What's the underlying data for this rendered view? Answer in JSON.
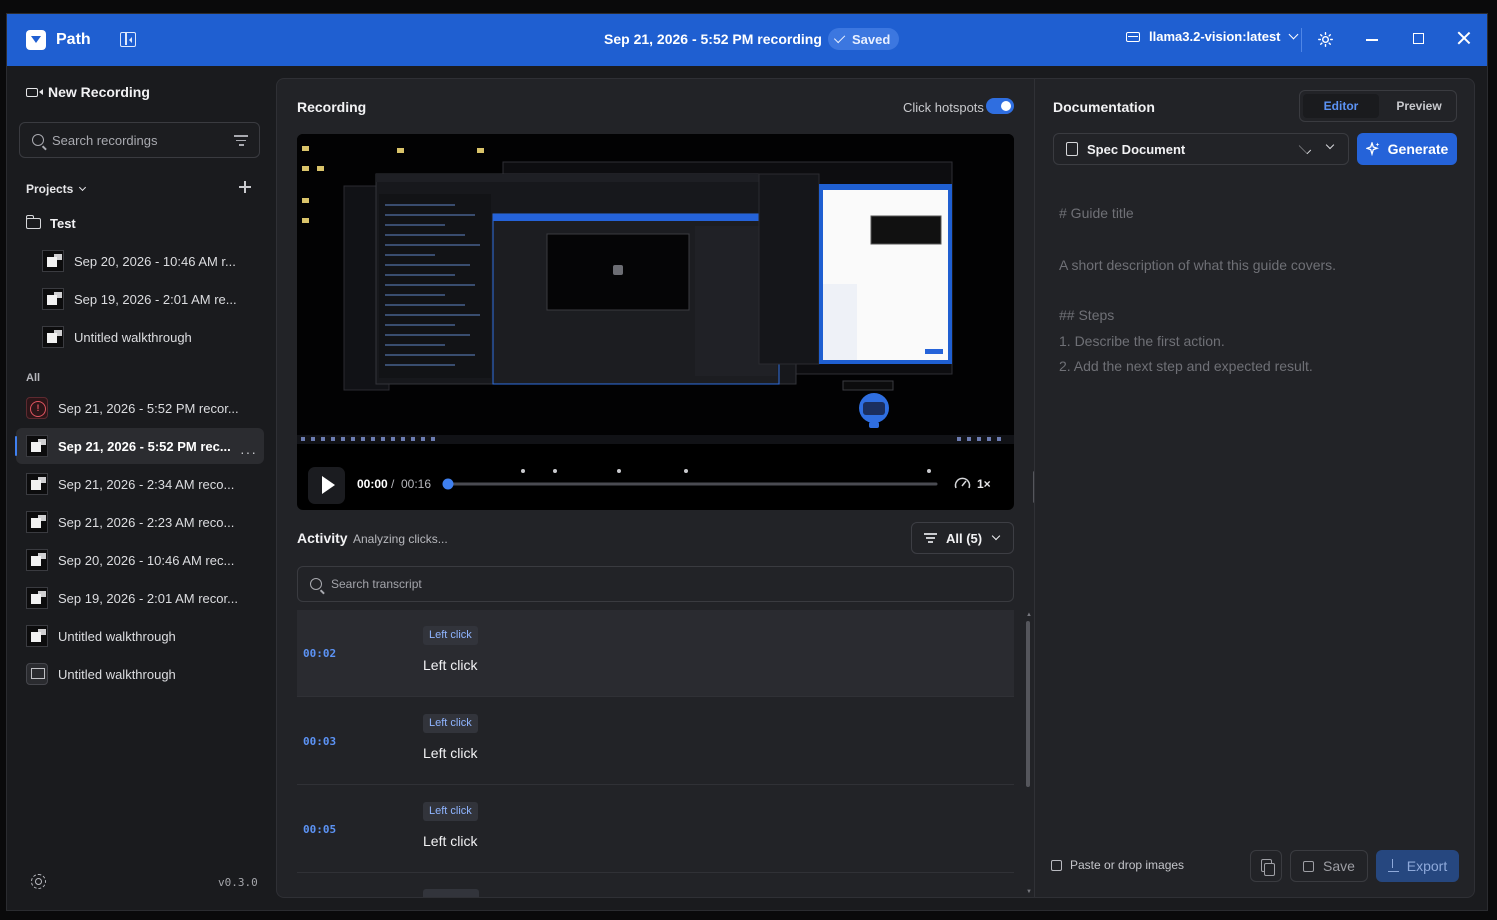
{
  "app": {
    "name": "Path",
    "doc_title": "Sep 21, 2026 - 5:52 PM recording",
    "saved_label": "Saved",
    "model": "llama3.2-vision:latest"
  },
  "sidebar": {
    "new_recording": "New Recording",
    "search_placeholder": "Search recordings",
    "projects_label": "Projects",
    "project": {
      "name": "Test",
      "items": [
        "Sep 20, 2026 - 10:46 AM r...",
        "Sep 19, 2026 - 2:01 AM re...",
        "Untitled walkthrough"
      ]
    },
    "all_label": "All",
    "all_items": [
      "Sep 21, 2026 - 5:52 PM recor...",
      "Sep 21, 2026 - 5:52 PM rec...",
      "Sep 21, 2026 - 2:34 AM reco...",
      "Sep 21, 2026 - 2:23 AM reco...",
      "Sep 20, 2026 - 10:46 AM rec...",
      "Sep 19, 2026 - 2:01 AM recor...",
      "Untitled walkthrough",
      "Untitled walkthrough"
    ],
    "more": "···",
    "version": "v0.3.0"
  },
  "recording": {
    "title": "Recording",
    "hotspots_label": "Click hotspots",
    "current_time": "00:00",
    "separator": "/",
    "duration": "00:16",
    "speed": "1×",
    "progress": 0.0
  },
  "activity": {
    "title": "Activity",
    "status": "Analyzing clicks...",
    "filter_label": "All (5)",
    "search_placeholder": "Search transcript",
    "rows": [
      {
        "time": "00:02",
        "tag": "Left click",
        "label": "Left click"
      },
      {
        "time": "00:03",
        "tag": "Left click",
        "label": "Left click"
      },
      {
        "time": "00:05",
        "tag": "Left click",
        "label": "Left click"
      }
    ]
  },
  "documentation": {
    "title": "Documentation",
    "tab_editor": "Editor",
    "tab_preview": "Preview",
    "template": "Spec Document",
    "generate": "Generate",
    "editor_lines": [
      "# Guide title",
      "A short description of what this guide covers.",
      "## Steps",
      "1. Describe the first action.",
      "2. Add the next step and expected result."
    ],
    "paste_hint": "Paste or drop images",
    "save": "Save",
    "export": "Export"
  },
  "colors": {
    "titlebar": "#1f5fd1",
    "accent": "#2563d9",
    "timestamp": "#5c93f5"
  }
}
